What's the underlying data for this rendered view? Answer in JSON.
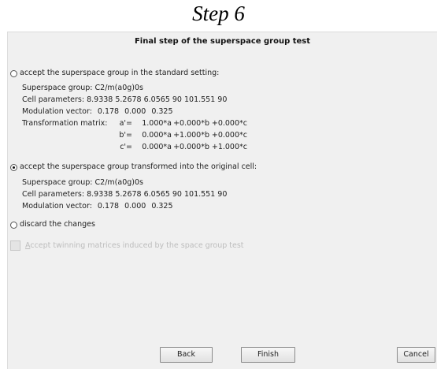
{
  "caption": "Step 6",
  "dialog": {
    "title": "Final step of the superspace group test",
    "option_standard": {
      "label": "accept the superspace group in the standard setting:",
      "checked": false,
      "superspace_group": "Superspace group: C2/m(a0g)0s",
      "cell_parameters": "Cell parameters: 8.9338 5.2678 6.0565 90 101.551 90",
      "modulation_vector_label": "Modulation vector:",
      "modulation_vector": [
        "0.178",
        "0.000",
        "0.325"
      ],
      "transformation_label": "Transformation matrix:",
      "matrix_rows": [
        {
          "name": "a'=",
          "terms": [
            "1.000*a",
            "+0.000*b",
            "+0.000*c"
          ]
        },
        {
          "name": "b'=",
          "terms": [
            "0.000*a",
            "+1.000*b",
            "+0.000*c"
          ]
        },
        {
          "name": "c'=",
          "terms": [
            "0.000*a",
            "+0.000*b",
            "+1.000*c"
          ]
        }
      ]
    },
    "option_original": {
      "label": "accept the superspace group transformed into the original cell:",
      "checked": true,
      "superspace_group": "Superspace group: C2/m(a0g)0s",
      "cell_parameters": "Cell parameters: 8.9338 5.2678 6.0565 90 101.551 90",
      "modulation_vector_label": "Modulation vector:",
      "modulation_vector": [
        "0.178",
        "0.000",
        "0.325"
      ]
    },
    "option_discard": {
      "label": "discard the changes",
      "checked": false
    },
    "twinning_checkbox": {
      "label_first": "A",
      "label_rest": "ccept twinning matrices induced by the space group test",
      "enabled": false,
      "checked": false
    },
    "buttons": {
      "back": "Back",
      "finish": "Finish",
      "cancel": "Cancel"
    }
  }
}
